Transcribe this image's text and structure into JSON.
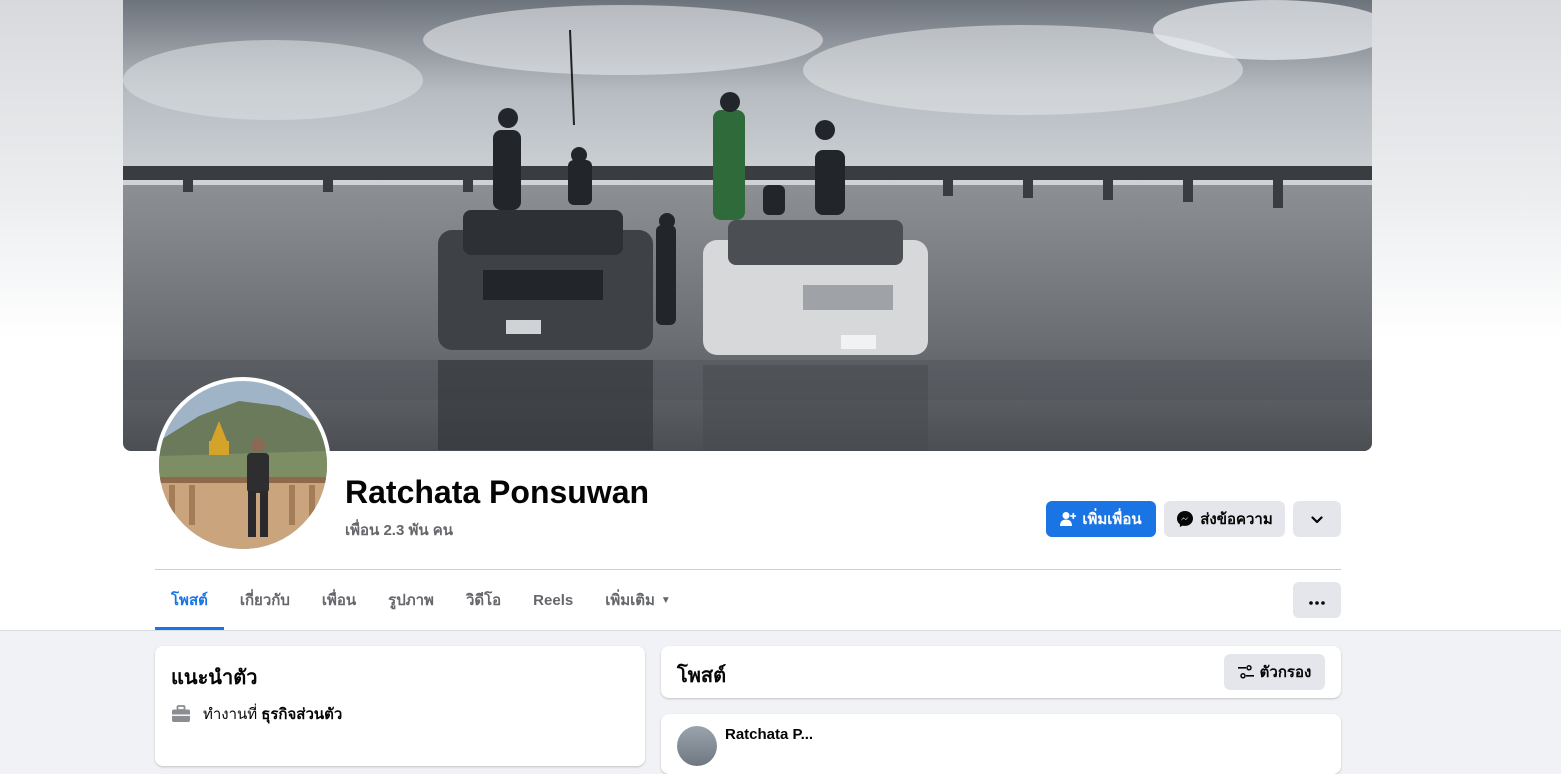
{
  "profile": {
    "name": "Ratchata Ponsuwan",
    "friends": "เพื่อน 2.3 พัน คน"
  },
  "actions": {
    "add_friend": "เพิ่มเพื่อน",
    "message": "ส่งข้อความ",
    "more_icon": "chevron-down-icon"
  },
  "tabs": [
    {
      "label": "โพสต์",
      "active": true
    },
    {
      "label": "เกี่ยวกับ",
      "active": false
    },
    {
      "label": "เพื่อน",
      "active": false
    },
    {
      "label": "รูปภาพ",
      "active": false
    },
    {
      "label": "วิดีโอ",
      "active": false
    },
    {
      "label": "Reels",
      "active": false
    },
    {
      "label": "เพิ่มเติม",
      "active": false
    }
  ],
  "intro": {
    "title": "แนะนำตัว",
    "work_prefix": "ทำงานที่",
    "work_place": "ธุรกิจส่วนตัว"
  },
  "posts": {
    "title": "โพสต์",
    "filter_label": "ตัวกรอง",
    "first_author": "Ratchata P..."
  },
  "colors": {
    "accent": "#1b74e4",
    "secondary_button": "#e4e6eb",
    "background": "#f0f2f5"
  }
}
